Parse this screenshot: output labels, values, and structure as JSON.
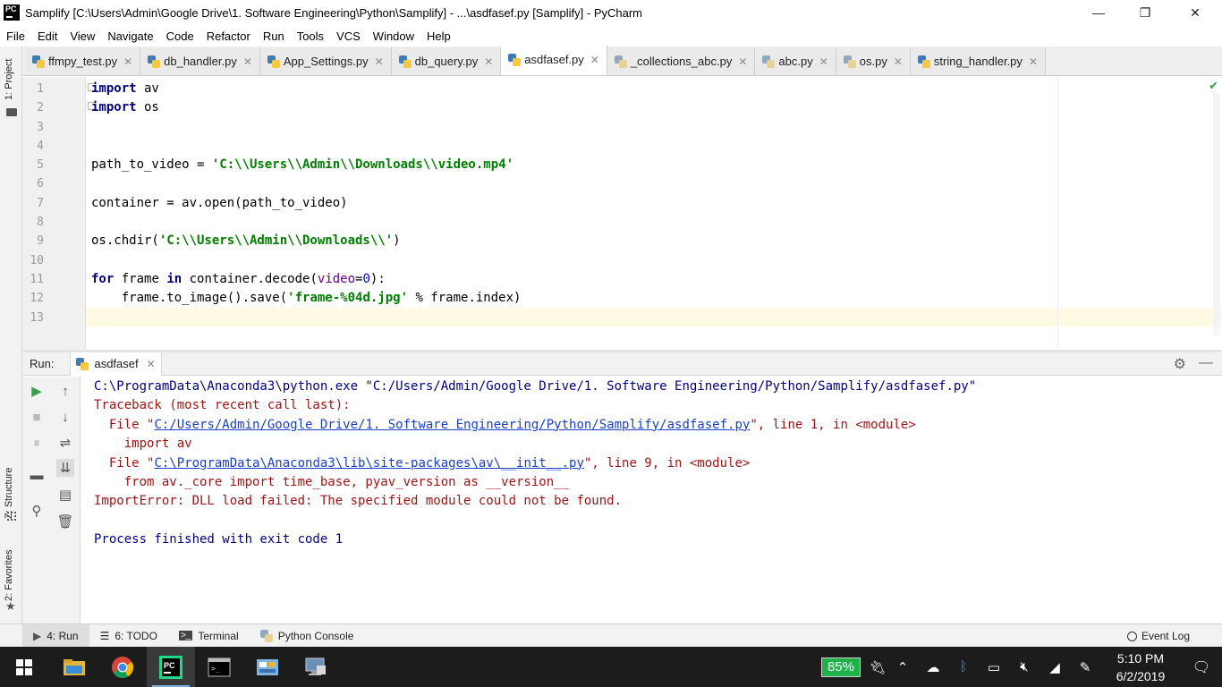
{
  "window": {
    "title": "Samplify [C:\\Users\\Admin\\Google Drive\\1. Software Engineering\\Python\\Samplify] - ...\\asdfasef.py [Samplify] - PyCharm",
    "app_icon_text": "PC",
    "minimize": "—",
    "maximize": "❐",
    "close": "✕"
  },
  "menu": {
    "items": [
      "File",
      "Edit",
      "View",
      "Navigate",
      "Code",
      "Refactor",
      "Run",
      "Tools",
      "VCS",
      "Window",
      "Help"
    ]
  },
  "left_strip": {
    "project_label": "1: Project",
    "structure_label": "Z: Structure",
    "favorites_label": "2: Favorites"
  },
  "tabs": [
    {
      "label": "ffmpy_test.py",
      "active": false,
      "icon": "python-file-icon"
    },
    {
      "label": "db_handler.py",
      "active": false,
      "icon": "python-file-icon"
    },
    {
      "label": "App_Settings.py",
      "active": false,
      "icon": "python-file-icon"
    },
    {
      "label": "db_query.py",
      "active": false,
      "icon": "python-file-icon"
    },
    {
      "label": "asdfasef.py",
      "active": true,
      "icon": "python-file-icon"
    },
    {
      "label": "_collections_abc.py",
      "active": false,
      "icon": "python-lib-icon"
    },
    {
      "label": "abc.py",
      "active": false,
      "icon": "python-lib-icon"
    },
    {
      "label": "os.py",
      "active": false,
      "icon": "python-lib-icon"
    },
    {
      "label": "string_handler.py",
      "active": false,
      "icon": "python-file-icon"
    }
  ],
  "editor": {
    "line_numbers": [
      "1",
      "2",
      "3",
      "4",
      "5",
      "6",
      "7",
      "8",
      "9",
      "10",
      "11",
      "12",
      "13"
    ],
    "code": {
      "l1_kw": "import",
      "l1_rest": " av",
      "l2_kw": "import",
      "l2_rest": " os",
      "l5_a": "path_to_video = ",
      "l5_str": "'C:\\\\Users\\\\Admin\\\\Downloads\\\\video.mp4'",
      "l7": "container = av.open(path_to_video)",
      "l9_a": "os.chdir(",
      "l9_str": "'C:\\\\Users\\\\Admin\\\\Downloads\\\\'",
      "l9_b": ")",
      "l11_kw1": "for",
      "l11_a": " frame ",
      "l11_kw2": "in",
      "l11_b": " container.decode(",
      "l11_param": "video",
      "l11_c": "=",
      "l11_num": "0",
      "l11_d": "):",
      "l12_a": "    frame.to_image().save(",
      "l12_str": "'frame-%04d.jpg'",
      "l12_b": " % frame.index)"
    }
  },
  "run_panel": {
    "label": "Run:",
    "tab_label": "asdfasef",
    "console": {
      "cmd": "C:\\ProgramData\\Anaconda3\\python.exe \"C:/Users/Admin/Google Drive/1. Software Engineering/Python/Samplify/asdfasef.py\"",
      "traceback": "Traceback (most recent call last):",
      "file1_prefix": "  File \"",
      "file1_link": "C:/Users/Admin/Google Drive/1. Software Engineering/Python/Samplify/asdfasef.py",
      "file1_suffix": "\", line 1, in <module>",
      "code1": "    import av",
      "file2_prefix": "  File \"",
      "file2_link": "C:\\ProgramData\\Anaconda3\\lib\\site-packages\\av\\__init__.py",
      "file2_suffix": "\", line 9, in <module>",
      "code2": "    from av._core import time_base, pyav_version as __version__",
      "error": "ImportError: DLL load failed: The specified module could not be found.",
      "finished": "Process finished with exit code 1"
    }
  },
  "bottom_bar": {
    "run": "4: Run",
    "todo": "6: TODO",
    "terminal": "Terminal",
    "python_console": "Python Console",
    "event_log": "Event Log"
  },
  "taskbar": {
    "battery": "85%",
    "time": "5:10 PM",
    "date": "6/2/2019"
  },
  "colors": {
    "keyword": "#000080",
    "string": "#008000",
    "error": "#a31515",
    "link": "#1a3fd4",
    "battery": "#1db24a"
  }
}
